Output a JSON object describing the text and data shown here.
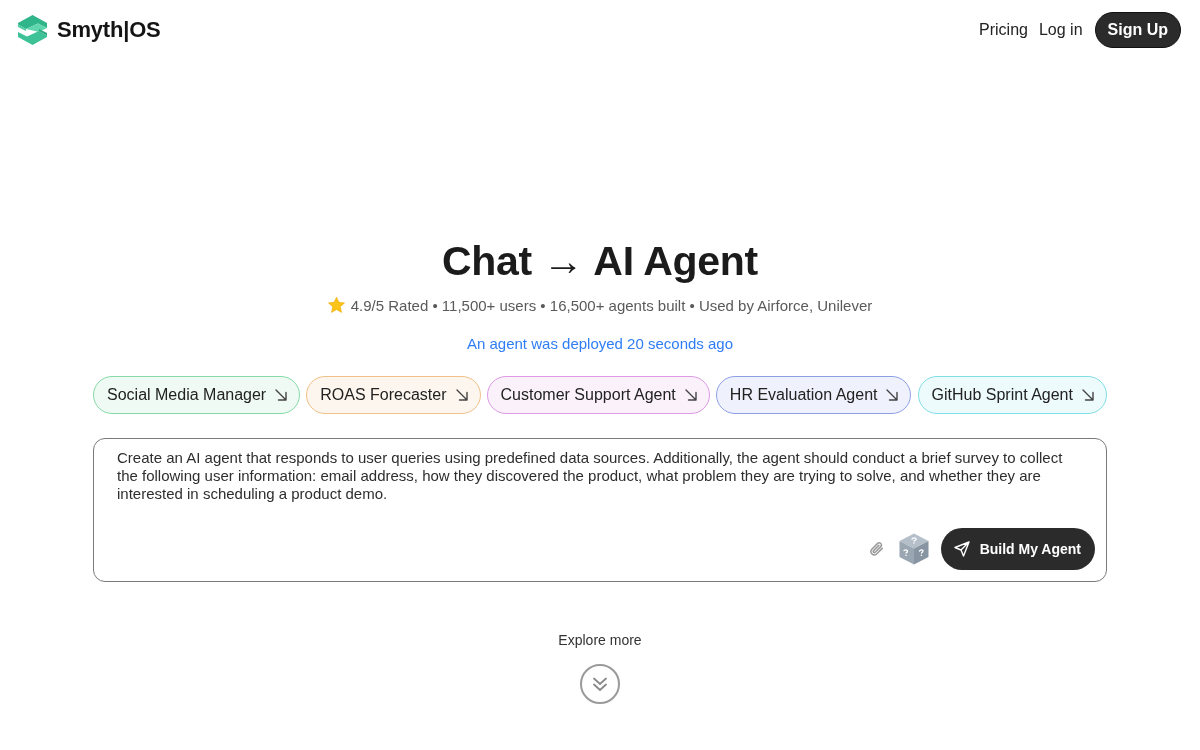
{
  "header": {
    "logo_text": "Smyth|OS",
    "nav_links": [
      "Pricing",
      "Log in"
    ],
    "cta_button": "Sign Up"
  },
  "hero": {
    "title": "Chat → AI Agent",
    "stats": "4.9/5 Rated • 11,500+ users • 16,500+ agents built • Used by Airforce, Unilever",
    "activity": "An agent was deployed 20 seconds ago"
  },
  "templates": [
    {
      "label": "Social Media Manager",
      "color": "#86dba8"
    },
    {
      "label": "ROAS Forecaster",
      "color": "#f0c088"
    },
    {
      "label": "Customer Support Agent",
      "color": "#de9ae4"
    },
    {
      "label": "HR Evaluation Agent",
      "color": "#8e9fe6"
    },
    {
      "label": "GitHub Sprint Agent",
      "color": "#7fdfe6"
    }
  ],
  "prompt": {
    "value": "Create an AI agent that responds to user queries using predefined data sources. Additionally, the agent should conduct a brief survey to collect the following user information: email address, how they discovered the product, what problem they are trying to solve, and whether they are interested in scheduling a product demo.",
    "submit_button": "Build My Agent"
  },
  "explore": {
    "label": "Explore more"
  }
}
